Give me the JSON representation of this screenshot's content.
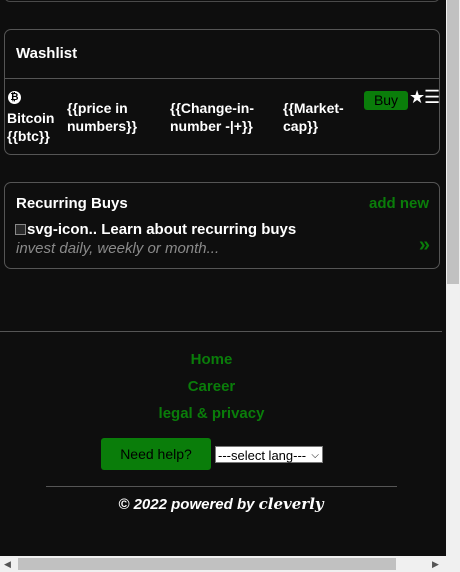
{
  "washlist": {
    "title": "Washlist",
    "coin_symbol": "₿",
    "coin_name": "Bitcoin",
    "coin_ticker": "{{btc}}",
    "price": "{{price in numbers}}",
    "change": "{{Change-in-number -|+}}",
    "market_cap": "{{Market-cap}}",
    "buy_label": "Buy",
    "star_icon": "★",
    "menu_icon": "☰"
  },
  "recurring": {
    "title": "Recurring Buys",
    "add_new": "add new",
    "img_alt": "svg-icon..",
    "learn": "Learn about recurring buys",
    "subtitle": "invest daily, weekly or month...",
    "chevron": "»"
  },
  "footer": {
    "links": [
      "Home",
      "Career",
      "legal & privacy"
    ],
    "help_button": "Need help?",
    "language_selected": "---select lang---",
    "copyright_prefix": "© 2022 powered by",
    "brand": "cleverly"
  },
  "colors": {
    "background": "#0e0e0e",
    "accent_green": "#0a7d0a",
    "text": "#ffffff",
    "muted": "#8a8a8a"
  }
}
